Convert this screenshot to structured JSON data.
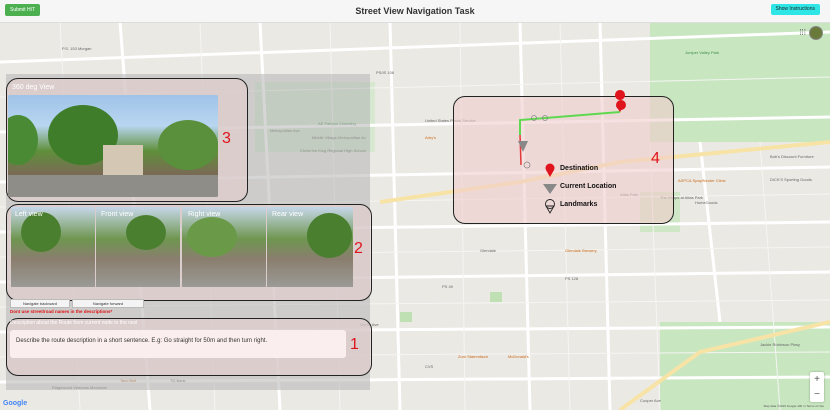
{
  "header": {
    "submit_label": "Submit HIT",
    "title": "Street View Navigation Task",
    "instructions_label": "Show Instructions"
  },
  "panel": {
    "view360_label": "360 deg View",
    "marker_3": "3",
    "views": [
      "Left view",
      "Front view",
      "Right view",
      "Rear view"
    ],
    "marker_2": "2",
    "nav_backward": "Navigate backward",
    "nav_forward": "Navigate forward",
    "warning": "Dont use street/road names in the descriptions*",
    "desc_label": "Description about the Route from current node to the next",
    "desc_placeholder": "Describe the route description in a short sentence. E.g: Go straight for 50m and then turn right.",
    "marker_1": "1"
  },
  "legend": {
    "destination": "Destination",
    "current_location": "Current Location",
    "landmarks": "Landmarks",
    "marker_4": "4"
  },
  "map": {
    "labels": {
      "ps": "P.S. 153 Morgan",
      "ps1": "PS/IS 108",
      "united_states_postal_service": "United States Postal Service",
      "ae": "AE Patricia Cemetery",
      "middle_village": "Middle Village-Metropolitan Av",
      "christ_the_king": "Christ the King Regional High School",
      "arbys": "Arby's",
      "ps2": "PS 128",
      "metropolitan_av": "Metropolitan Ave",
      "juniper_valley": "Juniper Valley Park",
      "bobs": "Bob's Discount Furniture",
      "dicks": "DICK'S Sporting Goods",
      "aspca": "ASPCA Spay/Neuter Clinic",
      "shops": "The Shops at Atlas Park",
      "homegoods": "HomeGoods",
      "ps49": "PS 49",
      "zum_stammtisch": "Zum Stammtisch",
      "mcdonalds": "McDonald's",
      "cvs": "CVS",
      "forest_hills": "Forest Hills",
      "atlas_park": "Atlas Park",
      "ridgewood": "Ridgewood Veterans Memorial",
      "taco_bell": "Taco Bell",
      "td_bank": "TD Bank",
      "cooper_ave": "Cooper Ave",
      "myrtle_ave": "Myrtle Ave",
      "jackie_robinson": "Jackie Robinson Pkwy",
      "glendale": "Glendale",
      "gal": "Glendale Brewery"
    },
    "attribution": "Map data ©2019 Google   100 m   Terms of Use",
    "google_logo": "Google",
    "zoom_in": "+",
    "zoom_out": "−"
  },
  "colors": {
    "route_green": "#5ed84e",
    "route_red": "#e43a3a",
    "marker_red": "#e0141c",
    "accent_cyan": "#2ee6e6",
    "submit_green": "#4caf50"
  }
}
